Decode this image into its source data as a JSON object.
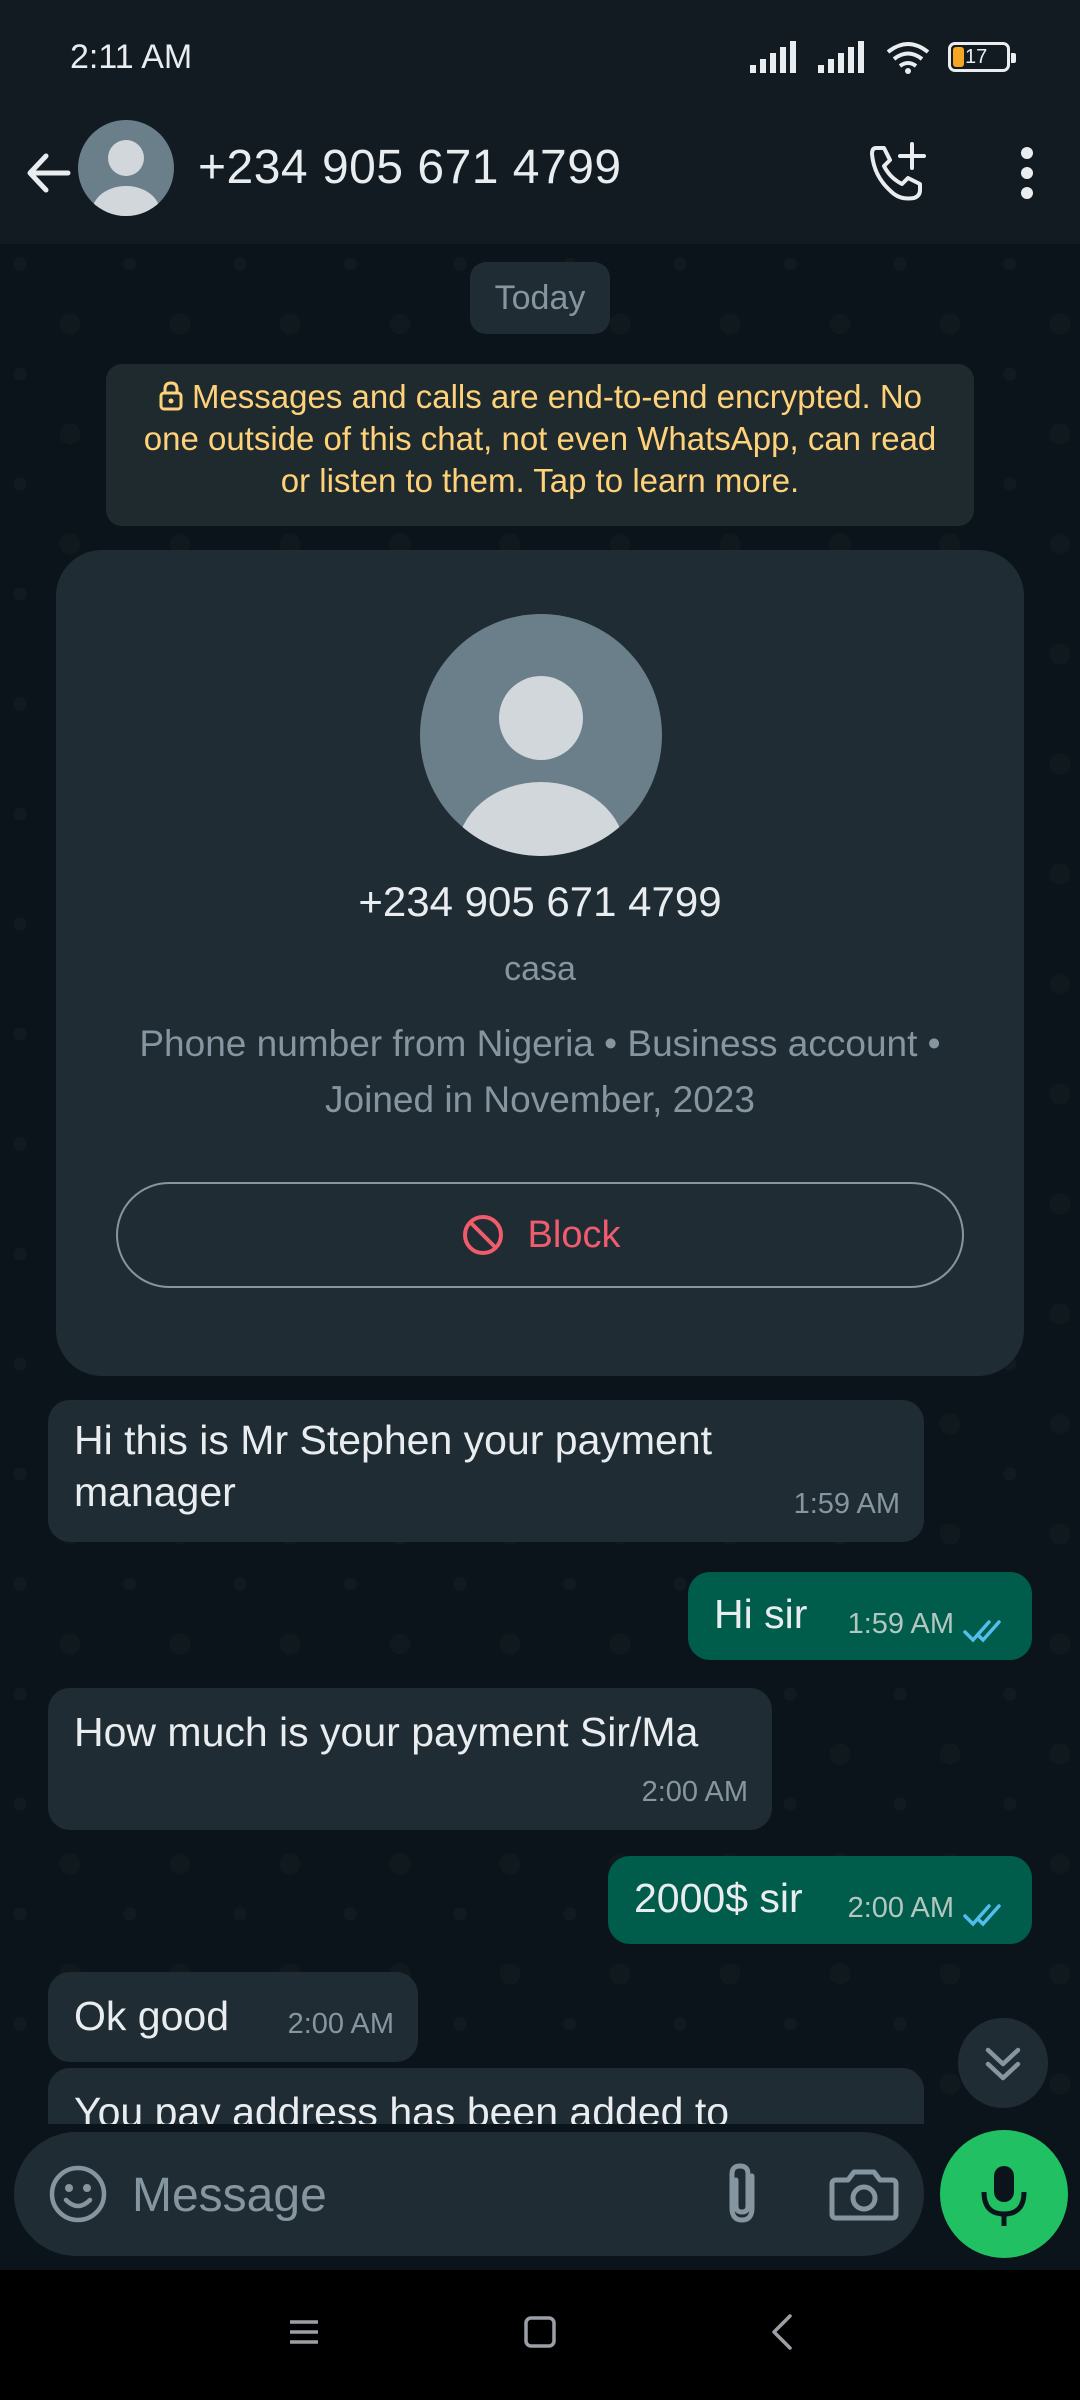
{
  "status_bar": {
    "time": "2:11 AM",
    "battery": "17",
    "icons": [
      "signal-icon",
      "signal-icon",
      "wifi-icon",
      "battery-icon"
    ]
  },
  "header": {
    "title": "+234 905 671 4799",
    "icons": [
      "back-arrow-icon",
      "avatar",
      "add-call-icon",
      "more-vertical-icon"
    ]
  },
  "chat": {
    "date_chip": "Today",
    "encryption_notice": "Messages and calls are end-to-end encrypted. No one outside of this chat, not even WhatsApp, can read or listen to them. Tap to learn more.",
    "contact_card": {
      "phone": "+234 905 671 4799",
      "name": "casa",
      "meta": "Phone number from Nigeria • Business account • Joined in November, 2023",
      "block_label": "Block"
    },
    "messages": [
      {
        "direction": "in",
        "text": "Hi this is Mr Stephen your payment manager",
        "time": "1:59 AM"
      },
      {
        "direction": "out",
        "text": "Hi sir",
        "time": "1:59 AM",
        "status": "read"
      },
      {
        "direction": "in",
        "text": "How much is your payment Sir/Ma",
        "time": "2:00 AM"
      },
      {
        "direction": "out",
        "text": "2000$ sir",
        "time": "2:00 AM",
        "status": "read"
      },
      {
        "direction": "in",
        "text": "Ok good",
        "time": "2:00 AM"
      },
      {
        "direction": "in",
        "text": "You pay address has been added to",
        "time": ""
      }
    ]
  },
  "composer": {
    "placeholder": "Message",
    "icons": [
      "emoji-icon",
      "attachment-icon",
      "camera-icon",
      "microphone-icon"
    ]
  },
  "colors": {
    "header_bg": "#111b21",
    "chat_bg": "#0b141a",
    "incoming_bubble": "#1f2c33",
    "outgoing_bubble": "#005c4b",
    "accent_green": "#21c063",
    "read_ticks": "#53bdeb",
    "block_red": "#f15c6d",
    "notice_yellow": "#ffd279"
  }
}
